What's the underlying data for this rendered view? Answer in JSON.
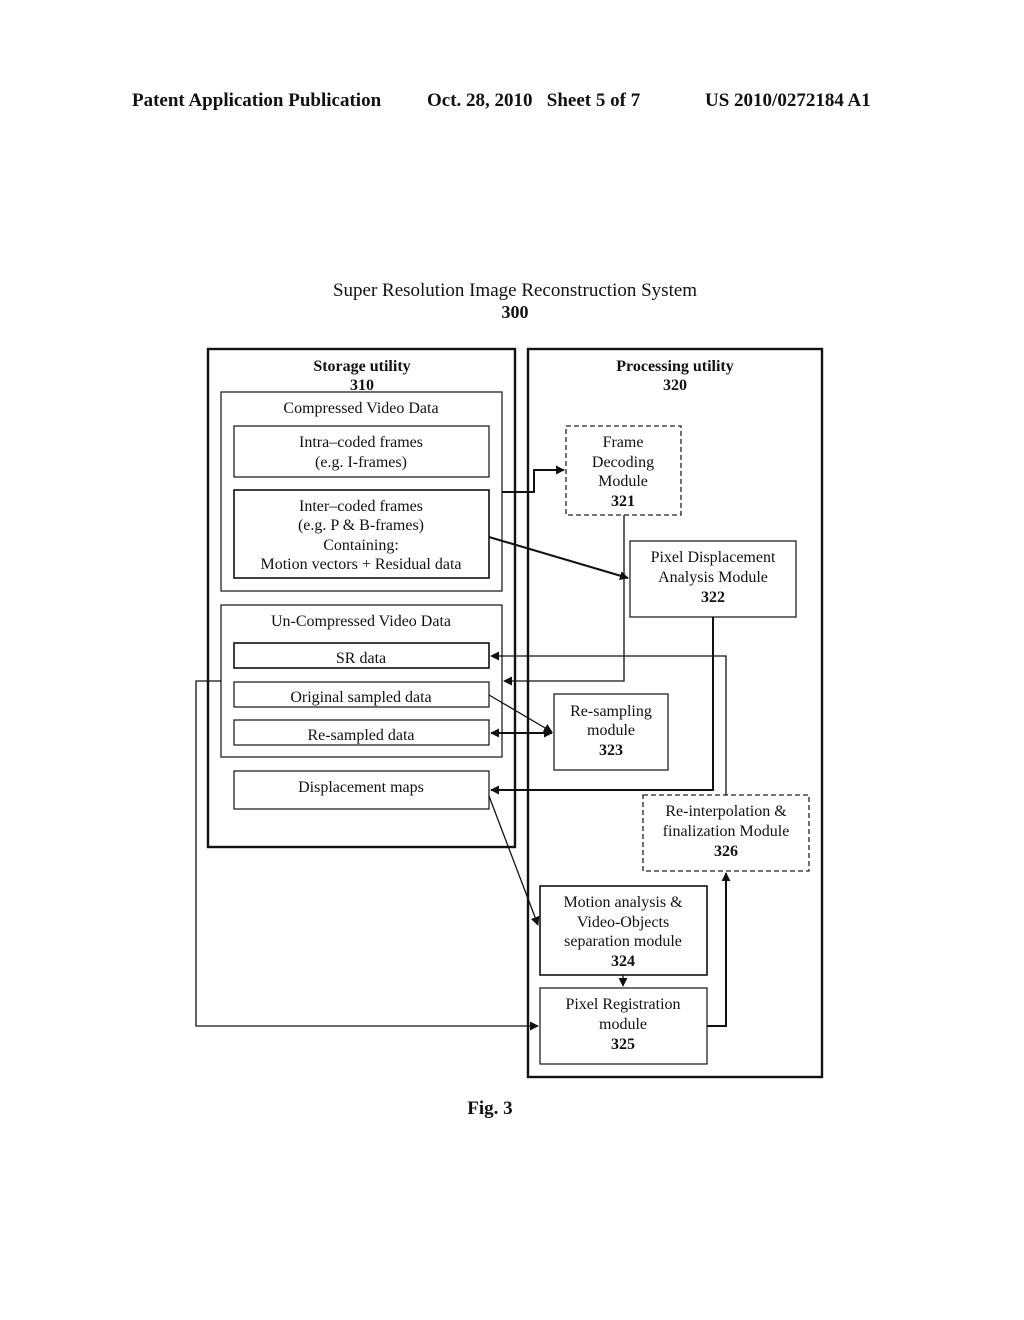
{
  "header": {
    "publication": "Patent Application Publication",
    "date_sheet": "Oct. 28, 2010   Sheet 5 of 7",
    "patent_number": "US 2010/0272184 A1"
  },
  "diagram": {
    "title": "Super Resolution Image Reconstruction System",
    "ref": "300",
    "storage": {
      "label": "Storage utility",
      "ref": "310",
      "compressed": {
        "label": "Compressed Video Data",
        "intra": [
          "Intra–coded frames",
          "(e.g. I-frames)"
        ],
        "inter": [
          "Inter–coded frames",
          "(e.g. P & B-frames)",
          "Containing:",
          "Motion vectors + Residual data"
        ]
      },
      "uncompressed": {
        "label": "Un-Compressed Video Data",
        "sr": "SR data",
        "original": "Original sampled data",
        "resampled": "Re-sampled data"
      },
      "displacement": "Displacement maps"
    },
    "processing": {
      "label": "Processing utility",
      "ref": "320",
      "modules": [
        {
          "lines": [
            "Frame",
            "Decoding",
            "Module"
          ],
          "ref": "321"
        },
        {
          "lines": [
            "Pixel Displacement",
            "Analysis Module"
          ],
          "ref": "322"
        },
        {
          "lines": [
            "Re-sampling",
            "module"
          ],
          "ref": "323"
        },
        {
          "lines": [
            "Motion analysis &",
            "Video-Objects",
            "separation module"
          ],
          "ref": "324"
        },
        {
          "lines": [
            "Pixel Registration",
            "module"
          ],
          "ref": "325"
        },
        {
          "lines": [
            "Re-interpolation &",
            "finalization Module"
          ],
          "ref": "326"
        }
      ]
    },
    "caption": "Fig. 3"
  }
}
